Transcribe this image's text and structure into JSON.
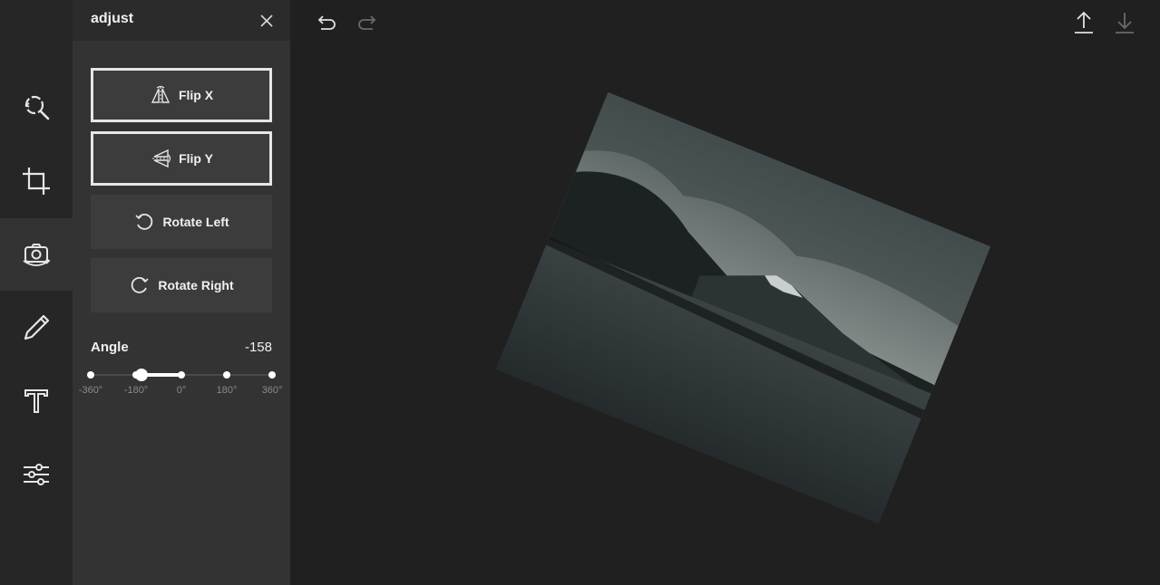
{
  "panel": {
    "title": "adjust",
    "buttons": {
      "flip_x": "Flip X",
      "flip_y": "Flip Y",
      "rotate_left": "Rotate Left",
      "rotate_right": "Rotate Right"
    },
    "angle": {
      "label": "Angle",
      "value": "-158",
      "ticks": [
        "-360°",
        "-180°",
        "0°",
        "180°",
        "360°"
      ]
    }
  },
  "toolbar": {
    "tools": [
      "filter-icon",
      "crop-icon",
      "adjust-camera-icon",
      "draw-icon",
      "text-icon",
      "sliders-icon"
    ],
    "active": "adjust-camera-icon"
  },
  "colors": {
    "background": "#202020",
    "toolbar": "#262626",
    "panel": "#333333",
    "active_tool": "#333333",
    "button": "#3c3c3c",
    "accent": "#ffffff"
  }
}
